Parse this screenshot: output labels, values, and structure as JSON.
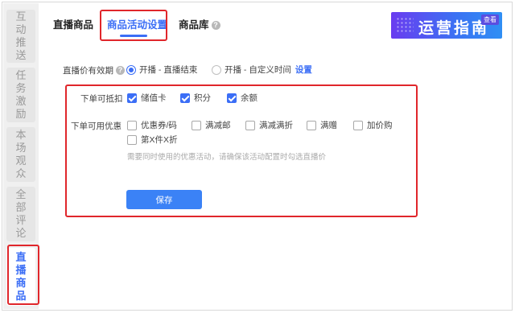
{
  "sidebar": {
    "items": [
      {
        "label": "互动推送"
      },
      {
        "label": "任务激励"
      },
      {
        "label": "本场观众"
      },
      {
        "label": "全部评论"
      },
      {
        "label": "直播商品"
      }
    ]
  },
  "tabs": [
    {
      "label": "直播商品"
    },
    {
      "label": "商品活动设置"
    },
    {
      "label": "商品库"
    }
  ],
  "banner": {
    "text": "运营指南",
    "badge": "查看"
  },
  "price_validity": {
    "label": "直播价有效期",
    "options": [
      {
        "label": "开播 - 直播结束",
        "selected": true
      },
      {
        "label": "开播 - 自定义时间",
        "selected": false
      }
    ],
    "settings_link": "设置"
  },
  "deduction": {
    "label": "下单可抵扣",
    "options": [
      {
        "label": "储值卡",
        "checked": true
      },
      {
        "label": "积分",
        "checked": true
      },
      {
        "label": "余额",
        "checked": true
      }
    ]
  },
  "discounts": {
    "label": "下单可用优惠",
    "options": [
      {
        "label": "优惠券/码",
        "checked": false
      },
      {
        "label": "满减邮",
        "checked": false
      },
      {
        "label": "满减满折",
        "checked": false
      },
      {
        "label": "满赠",
        "checked": false
      },
      {
        "label": "加价购",
        "checked": false
      },
      {
        "label": "第X件X折",
        "checked": false
      }
    ],
    "hint": "需要同时使用的优惠活动，请确保该活动配置时勾选直播价"
  },
  "save_button": {
    "label": "保存"
  },
  "colors": {
    "accent": "#3b6ef6",
    "highlight": "#e0262b"
  }
}
